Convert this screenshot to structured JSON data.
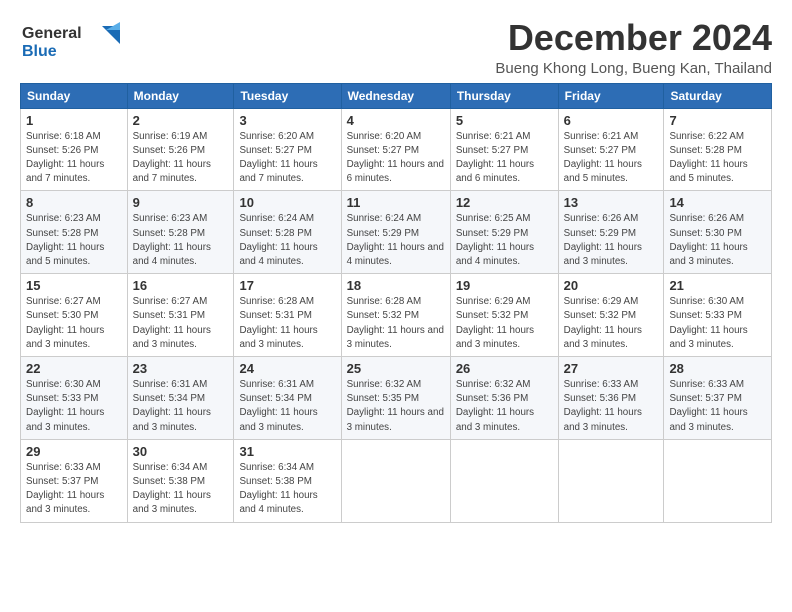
{
  "logo": {
    "line1": "General",
    "line2": "Blue"
  },
  "title": "December 2024",
  "location": "Bueng Khong Long, Bueng Kan, Thailand",
  "days_header": [
    "Sunday",
    "Monday",
    "Tuesday",
    "Wednesday",
    "Thursday",
    "Friday",
    "Saturday"
  ],
  "weeks": [
    [
      {
        "day": "1",
        "sunrise": "6:18 AM",
        "sunset": "5:26 PM",
        "daylight": "11 hours and 7 minutes."
      },
      {
        "day": "2",
        "sunrise": "6:19 AM",
        "sunset": "5:26 PM",
        "daylight": "11 hours and 7 minutes."
      },
      {
        "day": "3",
        "sunrise": "6:20 AM",
        "sunset": "5:27 PM",
        "daylight": "11 hours and 7 minutes."
      },
      {
        "day": "4",
        "sunrise": "6:20 AM",
        "sunset": "5:27 PM",
        "daylight": "11 hours and 6 minutes."
      },
      {
        "day": "5",
        "sunrise": "6:21 AM",
        "sunset": "5:27 PM",
        "daylight": "11 hours and 6 minutes."
      },
      {
        "day": "6",
        "sunrise": "6:21 AM",
        "sunset": "5:27 PM",
        "daylight": "11 hours and 5 minutes."
      },
      {
        "day": "7",
        "sunrise": "6:22 AM",
        "sunset": "5:28 PM",
        "daylight": "11 hours and 5 minutes."
      }
    ],
    [
      {
        "day": "8",
        "sunrise": "6:23 AM",
        "sunset": "5:28 PM",
        "daylight": "11 hours and 5 minutes."
      },
      {
        "day": "9",
        "sunrise": "6:23 AM",
        "sunset": "5:28 PM",
        "daylight": "11 hours and 4 minutes."
      },
      {
        "day": "10",
        "sunrise": "6:24 AM",
        "sunset": "5:28 PM",
        "daylight": "11 hours and 4 minutes."
      },
      {
        "day": "11",
        "sunrise": "6:24 AM",
        "sunset": "5:29 PM",
        "daylight": "11 hours and 4 minutes."
      },
      {
        "day": "12",
        "sunrise": "6:25 AM",
        "sunset": "5:29 PM",
        "daylight": "11 hours and 4 minutes."
      },
      {
        "day": "13",
        "sunrise": "6:26 AM",
        "sunset": "5:29 PM",
        "daylight": "11 hours and 3 minutes."
      },
      {
        "day": "14",
        "sunrise": "6:26 AM",
        "sunset": "5:30 PM",
        "daylight": "11 hours and 3 minutes."
      }
    ],
    [
      {
        "day": "15",
        "sunrise": "6:27 AM",
        "sunset": "5:30 PM",
        "daylight": "11 hours and 3 minutes."
      },
      {
        "day": "16",
        "sunrise": "6:27 AM",
        "sunset": "5:31 PM",
        "daylight": "11 hours and 3 minutes."
      },
      {
        "day": "17",
        "sunrise": "6:28 AM",
        "sunset": "5:31 PM",
        "daylight": "11 hours and 3 minutes."
      },
      {
        "day": "18",
        "sunrise": "6:28 AM",
        "sunset": "5:32 PM",
        "daylight": "11 hours and 3 minutes."
      },
      {
        "day": "19",
        "sunrise": "6:29 AM",
        "sunset": "5:32 PM",
        "daylight": "11 hours and 3 minutes."
      },
      {
        "day": "20",
        "sunrise": "6:29 AM",
        "sunset": "5:32 PM",
        "daylight": "11 hours and 3 minutes."
      },
      {
        "day": "21",
        "sunrise": "6:30 AM",
        "sunset": "5:33 PM",
        "daylight": "11 hours and 3 minutes."
      }
    ],
    [
      {
        "day": "22",
        "sunrise": "6:30 AM",
        "sunset": "5:33 PM",
        "daylight": "11 hours and 3 minutes."
      },
      {
        "day": "23",
        "sunrise": "6:31 AM",
        "sunset": "5:34 PM",
        "daylight": "11 hours and 3 minutes."
      },
      {
        "day": "24",
        "sunrise": "6:31 AM",
        "sunset": "5:34 PM",
        "daylight": "11 hours and 3 minutes."
      },
      {
        "day": "25",
        "sunrise": "6:32 AM",
        "sunset": "5:35 PM",
        "daylight": "11 hours and 3 minutes."
      },
      {
        "day": "26",
        "sunrise": "6:32 AM",
        "sunset": "5:36 PM",
        "daylight": "11 hours and 3 minutes."
      },
      {
        "day": "27",
        "sunrise": "6:33 AM",
        "sunset": "5:36 PM",
        "daylight": "11 hours and 3 minutes."
      },
      {
        "day": "28",
        "sunrise": "6:33 AM",
        "sunset": "5:37 PM",
        "daylight": "11 hours and 3 minutes."
      }
    ],
    [
      {
        "day": "29",
        "sunrise": "6:33 AM",
        "sunset": "5:37 PM",
        "daylight": "11 hours and 3 minutes."
      },
      {
        "day": "30",
        "sunrise": "6:34 AM",
        "sunset": "5:38 PM",
        "daylight": "11 hours and 3 minutes."
      },
      {
        "day": "31",
        "sunrise": "6:34 AM",
        "sunset": "5:38 PM",
        "daylight": "11 hours and 4 minutes."
      },
      null,
      null,
      null,
      null
    ]
  ]
}
